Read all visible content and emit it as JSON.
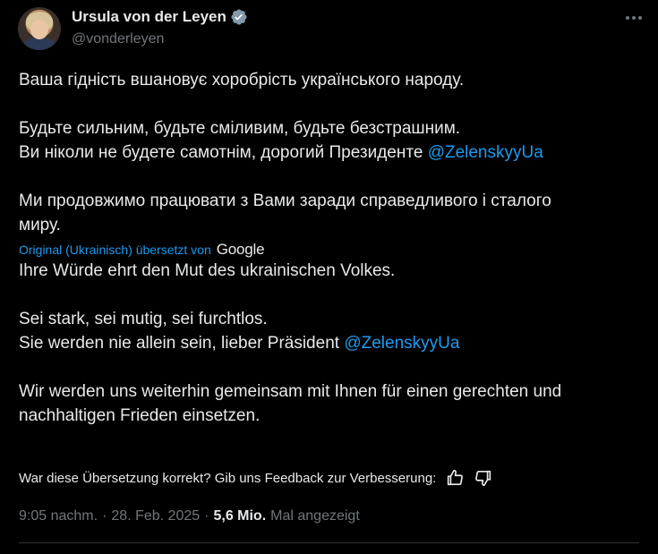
{
  "author": {
    "display_name": "Ursula von der Leyen",
    "handle": "@vonderleyen",
    "verified": true,
    "verified_color": "#829aab"
  },
  "tweet": {
    "original": {
      "line1": "Ваша гідність вшановує хоробрість українського народу.",
      "line2": "Будьте сильним, будьте сміливим, будьте безстрашним.",
      "line3_text": "Ви ніколи не будете самотнім, дорогий Президенте ",
      "line3_mention": "@ZelenskyyUa",
      "line4a": "Ми продовжимо працювати з Вами заради справедливого і сталого",
      "line4b": "миру."
    },
    "translation_note": "Original (Ukrainisch) übersetzt von",
    "translation_provider": "Google",
    "translated": {
      "line1": "Ihre Würde ehrt den Mut des ukrainischen Volkes.",
      "line2": "Sei stark, sei mutig, sei furchtlos.",
      "line3_text": "Sie werden nie allein sein, lieber Präsident ",
      "line3_mention": "@ZelenskyyUa",
      "line4a": "Wir werden uns weiterhin gemeinsam mit Ihnen für einen gerechten und",
      "line4b": "nachhaltigen Frieden einsetzen."
    },
    "feedback_prompt": "War diese Übersetzung korrekt? Gib uns Feedback zur Verbesserung:",
    "time": "9:05 nachm.",
    "separator": "·",
    "date": "28. Feb. 2025",
    "views": "5,6 Mio.",
    "views_label": "Mal angezeigt"
  },
  "colors": {
    "background": "#000000",
    "text": "#e7e9ea",
    "secondary": "#71767b",
    "accent": "#1d9bf0",
    "divider": "#2f3336"
  },
  "icons": [
    "verified-badge-icon",
    "more-options-icon",
    "thumbs-up-icon",
    "thumbs-down-icon"
  ]
}
